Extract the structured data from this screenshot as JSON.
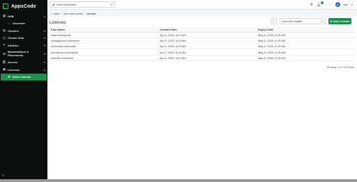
{
  "brand": {
    "logo_text": "AppsCode"
  },
  "sidebar": {
    "items": [
      {
        "label": "HUB",
        "icon": "grid-icon",
        "chevron": "▴"
      },
      {
        "label": "Overview",
        "icon": "home-icon",
        "sub": true
      },
      {
        "label": "Clusters",
        "icon": "server-icon",
        "chevron": "▾"
      },
      {
        "label": "Cluster Sets",
        "icon": "layers-icon",
        "chevron": "▾"
      },
      {
        "label": "AddOns",
        "icon": "puzzle-icon",
        "chevron": "▾"
      },
      {
        "label": "ManifestWork & Placements",
        "icon": "shuffle-icon",
        "chevron": "▾"
      },
      {
        "label": "Access",
        "icon": "key-icon",
        "chevron": "▾"
      },
      {
        "label": "Licenses",
        "icon": "license-icon",
        "chevron": "▴"
      },
      {
        "label": "Issue License",
        "icon": "puzzle-icon",
        "active": true
      }
    ],
    "collapse_icon": "«"
  },
  "topbar": {
    "cluster": "ocm-hub-cluster",
    "user_initial": "A",
    "user_name": "ace",
    "notif_count": "1"
  },
  "breadcrumb": {
    "items": [
      "hubs",
      "ocm-hub-cluster",
      "license"
    ]
  },
  "main": {
    "title": "Licenses",
    "cluster_filter": "ocm-hub-cluster",
    "add_button": "Add License",
    "columns": [
      "Plan Name",
      "Created Date",
      "Expiry Date"
    ],
    "rows": [
      [
        "stash-enterprise",
        "Apr 6, 2026, 6:29 AM",
        "May 6, 2026, 6:29 AM"
      ],
      [
        "configsyncer-enterprise",
        "Apr 6, 2026, 6:29 AM",
        "May 6, 2026, 6:29 AM"
      ],
      [
        "kubevault-enterprise",
        "Apr 6, 2026, 6:29 AM",
        "May 6, 2026, 6:29 AM"
      ],
      [
        "panopticon-enterprise",
        "Apr 6, 2026, 6:29 AM",
        "May 6, 2026, 6:29 AM"
      ],
      [
        "kubedb-enterprise",
        "Apr 6, 2026, 6:29 AM",
        "May 6, 2026, 6:29 AM"
      ]
    ],
    "pager": "Showing 1 to 5 of 5 items"
  },
  "colors": {
    "accent": "#1e8f4e",
    "sidebar_bg": "#0b0f0d"
  }
}
